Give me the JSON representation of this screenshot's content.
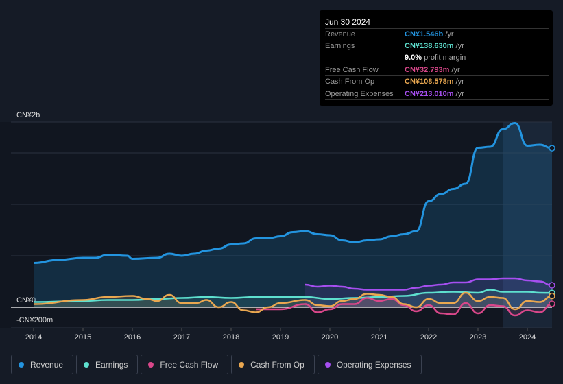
{
  "tooltip": {
    "date": "Jun 30 2024",
    "rows": [
      {
        "label": "Revenue",
        "value": "CN¥1.546b",
        "unit": " /yr",
        "color": "#2394df"
      },
      {
        "label": "Earnings",
        "value": "CN¥138.630m",
        "unit": " /yr",
        "color": "#5ee0cf"
      },
      {
        "label": "",
        "value": "9.0%",
        "unit": " profit margin",
        "color": "#ffffff"
      },
      {
        "label": "Free Cash Flow",
        "value": "CN¥32.793m",
        "unit": " /yr",
        "color": "#d9478a"
      },
      {
        "label": "Cash From Op",
        "value": "CN¥108.578m",
        "unit": " /yr",
        "color": "#e9a750"
      },
      {
        "label": "Operating Expenses",
        "value": "CN¥213.010m",
        "unit": " /yr",
        "color": "#a64ff0"
      }
    ]
  },
  "chart_data": {
    "type": "line",
    "ylabels": {
      "top": "CN¥2b",
      "zero": "CN¥0",
      "bottom": "-CN¥200m"
    },
    "ylim": [
      -0.2,
      1.8
    ],
    "xlim": [
      2013.5,
      2024.5
    ],
    "unit": "CN¥ billions",
    "xticks": [
      "2014",
      "2015",
      "2016",
      "2017",
      "2018",
      "2019",
      "2020",
      "2021",
      "2022",
      "2023",
      "2024"
    ],
    "highlight_from": 2023.5,
    "series": [
      {
        "name": "Revenue",
        "color": "#2394df",
        "fill": true,
        "x": [
          2014,
          2014.5,
          2015,
          2015.25,
          2015.5,
          2015.9,
          2016,
          2016.5,
          2016.75,
          2017,
          2017.25,
          2017.5,
          2017.75,
          2018,
          2018.25,
          2018.5,
          2018.75,
          2019,
          2019.25,
          2019.5,
          2019.75,
          2020,
          2020.25,
          2020.5,
          2020.75,
          2021,
          2021.25,
          2021.5,
          2021.75,
          2022,
          2022.25,
          2022.5,
          2022.75,
          2023,
          2023.25,
          2023.5,
          2023.75,
          2024,
          2024.25,
          2024.5
        ],
        "y": [
          0.43,
          0.46,
          0.48,
          0.48,
          0.51,
          0.5,
          0.47,
          0.48,
          0.52,
          0.5,
          0.52,
          0.55,
          0.57,
          0.61,
          0.62,
          0.67,
          0.67,
          0.69,
          0.73,
          0.74,
          0.71,
          0.7,
          0.65,
          0.63,
          0.65,
          0.66,
          0.69,
          0.71,
          0.74,
          1.03,
          1.1,
          1.15,
          1.2,
          1.55,
          1.56,
          1.73,
          1.79,
          1.57,
          1.58,
          1.546
        ]
      },
      {
        "name": "Earnings",
        "color": "#5ee0cf",
        "fill": true,
        "x": [
          2014,
          2015,
          2015.5,
          2016,
          2016.5,
          2017,
          2017.5,
          2018,
          2018.5,
          2019,
          2019.5,
          2020,
          2020.5,
          2021,
          2021.5,
          2022,
          2022.5,
          2023,
          2023.25,
          2023.5,
          2024,
          2024.25,
          2024.5
        ],
        "y": [
          0.05,
          0.06,
          0.07,
          0.07,
          0.08,
          0.09,
          0.1,
          0.09,
          0.1,
          0.1,
          0.1,
          0.08,
          0.09,
          0.1,
          0.11,
          0.14,
          0.15,
          0.14,
          0.17,
          0.15,
          0.15,
          0.14,
          0.139
        ]
      },
      {
        "name": "Free Cash Flow",
        "color": "#d9478a",
        "fill": true,
        "x": [
          2018.5,
          2019,
          2019.5,
          2019.75,
          2020,
          2020.25,
          2020.5,
          2020.75,
          2021,
          2021.25,
          2021.5,
          2021.75,
          2022,
          2022.25,
          2022.5,
          2022.75,
          2023,
          2023.25,
          2023.5,
          2023.75,
          2024,
          2024.25,
          2024.5
        ],
        "y": [
          -0.02,
          -0.02,
          0.03,
          -0.05,
          -0.02,
          0.03,
          0.03,
          0.09,
          0.06,
          0.08,
          0.02,
          -0.04,
          0.02,
          -0.06,
          -0.07,
          0.04,
          -0.06,
          0.02,
          0.01,
          -0.08,
          -0.03,
          -0.05,
          0.033
        ]
      },
      {
        "name": "Cash From Op",
        "color": "#e9a750",
        "fill": true,
        "x": [
          2014,
          2015,
          2015.5,
          2016,
          2016.3,
          2016.5,
          2016.75,
          2017,
          2017.3,
          2017.5,
          2017.75,
          2018,
          2018.25,
          2018.5,
          2018.75,
          2019,
          2019.5,
          2019.75,
          2020,
          2020.25,
          2020.5,
          2020.75,
          2021,
          2021.25,
          2021.5,
          2021.75,
          2022,
          2022.25,
          2022.5,
          2022.75,
          2023,
          2023.25,
          2023.5,
          2023.75,
          2024,
          2024.25,
          2024.5
        ],
        "y": [
          0.03,
          0.07,
          0.1,
          0.11,
          0.08,
          0.06,
          0.12,
          0.04,
          0.04,
          0.07,
          0,
          0.05,
          -0.03,
          -0.05,
          0,
          0.04,
          0.07,
          0.02,
          0.01,
          0.06,
          0.08,
          0.13,
          0.12,
          0.1,
          0.03,
          0,
          0.08,
          0.04,
          0.04,
          0.14,
          0.06,
          0.1,
          0.09,
          -0.02,
          0.06,
          0.05,
          0.109
        ]
      },
      {
        "name": "Operating Expenses",
        "color": "#a64ff0",
        "fill": true,
        "x": [
          2019.5,
          2019.75,
          2020,
          2020.25,
          2020.5,
          2020.75,
          2021,
          2021.25,
          2021.5,
          2021.75,
          2022,
          2022.25,
          2022.5,
          2022.75,
          2023,
          2023.25,
          2023.5,
          2023.75,
          2024,
          2024.25,
          2024.5
        ],
        "y": [
          0.22,
          0.2,
          0.21,
          0.2,
          0.18,
          0.17,
          0.17,
          0.17,
          0.17,
          0.19,
          0.21,
          0.22,
          0.24,
          0.24,
          0.27,
          0.27,
          0.28,
          0.28,
          0.26,
          0.25,
          0.213
        ]
      }
    ]
  },
  "legend": [
    "Revenue",
    "Earnings",
    "Free Cash Flow",
    "Cash From Op",
    "Operating Expenses"
  ]
}
